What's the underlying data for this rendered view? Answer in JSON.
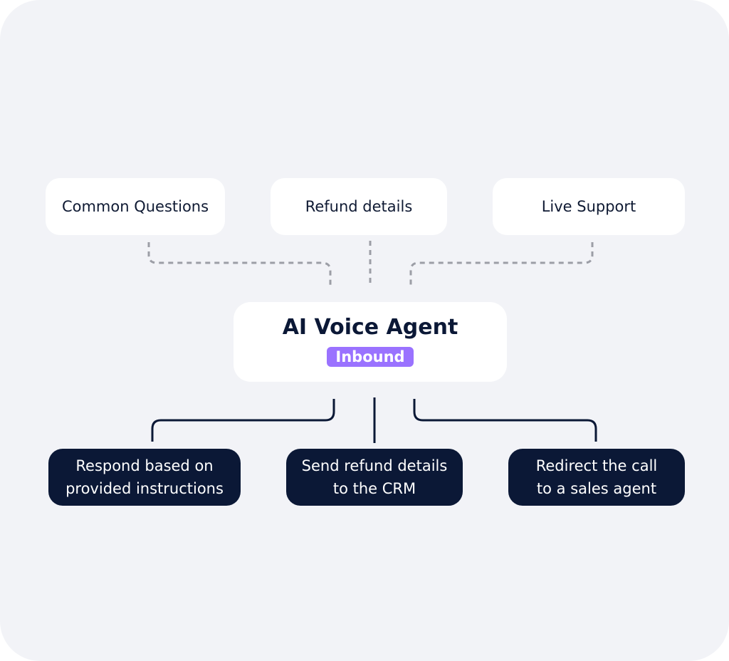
{
  "diagram": {
    "inputs": [
      {
        "label": "Common Questions"
      },
      {
        "label": "Refund details"
      },
      {
        "label": "Live Support"
      }
    ],
    "center": {
      "title": "AI Voice Agent",
      "badge": "Inbound"
    },
    "outputs": [
      {
        "line1": "Respond based on",
        "line2": "provided instructions"
      },
      {
        "line1": "Send refund details",
        "line2": "to the CRM"
      },
      {
        "line1": "Redirect the call",
        "line2": "to a sales agent"
      }
    ],
    "colors": {
      "background": "#f2f3f7",
      "navy": "#0b1836",
      "accent": "#9a72ff",
      "dashed": "#9c9ea6"
    }
  }
}
